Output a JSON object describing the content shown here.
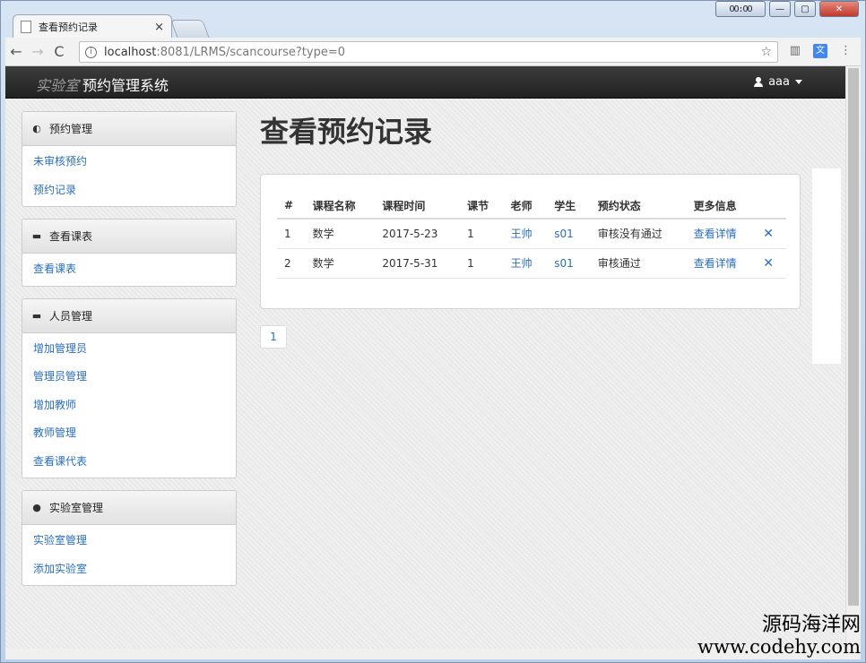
{
  "browser": {
    "tab_title": "查看预约记录",
    "tab_close": "×",
    "url_host": "localhost",
    "url_rest": ":8081/LRMS/scancourse?type=0",
    "info_glyph": "i",
    "star_glyph": "☆",
    "back_glyph": "←",
    "forward_glyph": "→",
    "reload_glyph": "C",
    "menu_glyph": "⋮",
    "translate_glyph": "文"
  },
  "window_controls": {
    "user": "OO:OO",
    "min": "—",
    "max": "▢",
    "close": "✕"
  },
  "navbar": {
    "brand_thin": "实验室",
    "brand_bold": "预约管理系统",
    "user": "aaa"
  },
  "sidebar": {
    "sections": [
      {
        "icon": "dashboard-icon",
        "glyph": "◐",
        "title": "预约管理",
        "items": [
          "未审核预约",
          "预约记录"
        ]
      },
      {
        "icon": "briefcase-icon",
        "glyph": "▬",
        "title": "查看课表",
        "items": [
          "查看课表"
        ]
      },
      {
        "icon": "briefcase-icon",
        "glyph": "▬",
        "title": "人员管理",
        "items": [
          "增加管理员",
          "管理员管理",
          "增加教师",
          "教师管理",
          "查看课代表"
        ]
      },
      {
        "icon": "alert-icon",
        "glyph": "●",
        "title": "实验室管理",
        "items": [
          "实验室管理",
          "添加实验室"
        ]
      }
    ]
  },
  "main": {
    "title": "查看预约记录",
    "table": {
      "headers": [
        "#",
        "课程名称",
        "课程时间",
        "课节",
        "老师",
        "学生",
        "预约状态",
        "更多信息",
        ""
      ],
      "rows": [
        {
          "num": "1",
          "course": "数学",
          "date": "2017-5-23",
          "period": "1",
          "teacher": "王帅",
          "student": "s01",
          "status": "审核没有通过",
          "more": "查看详情",
          "delete": "✕"
        },
        {
          "num": "2",
          "course": "数学",
          "date": "2017-5-31",
          "period": "1",
          "teacher": "王帅",
          "student": "s01",
          "status": "审核通过",
          "more": "查看详情",
          "delete": "✕"
        }
      ]
    },
    "pager": "1"
  },
  "watermark": {
    "site_cn": "源码海洋网",
    "site_url": "www.codehy.com"
  }
}
